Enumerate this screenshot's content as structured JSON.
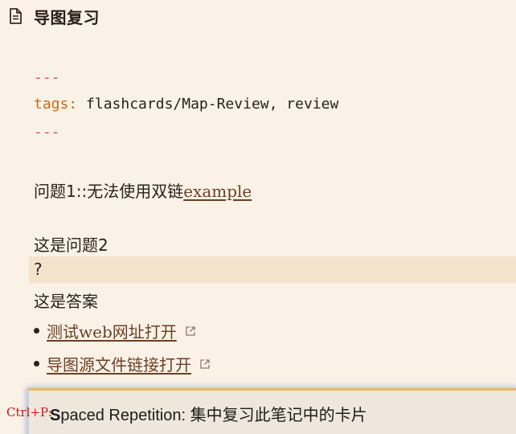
{
  "note": {
    "title": "导图复习",
    "frontmatter": {
      "delimiter": "---",
      "key": "tags",
      "colon": ":",
      "value": " flashcards/Map-Review, review"
    },
    "cards": {
      "q1_text": "问题1::无法使用双链",
      "q1_link": "example",
      "q2_text": "这是问题2",
      "separator": "?",
      "answer": "这是答案"
    },
    "links": [
      {
        "label": "测试web网址打开",
        "icon": "external-link-icon"
      },
      {
        "label": "导图源文件链接打开",
        "icon": "external-link-icon"
      }
    ]
  },
  "palette": {
    "hotkey": "Ctrl+P:",
    "match_char": "S",
    "rest": "paced Repetition: 集中复习此笔记中的卡片"
  },
  "colors": {
    "background": "#fbf2e7",
    "frontmatter_dash": "#d0574c",
    "frontmatter_key": "#c96a1c",
    "link": "#6b3f25",
    "highlight": "#f5e4cd",
    "hotkey": "#c8181c"
  }
}
